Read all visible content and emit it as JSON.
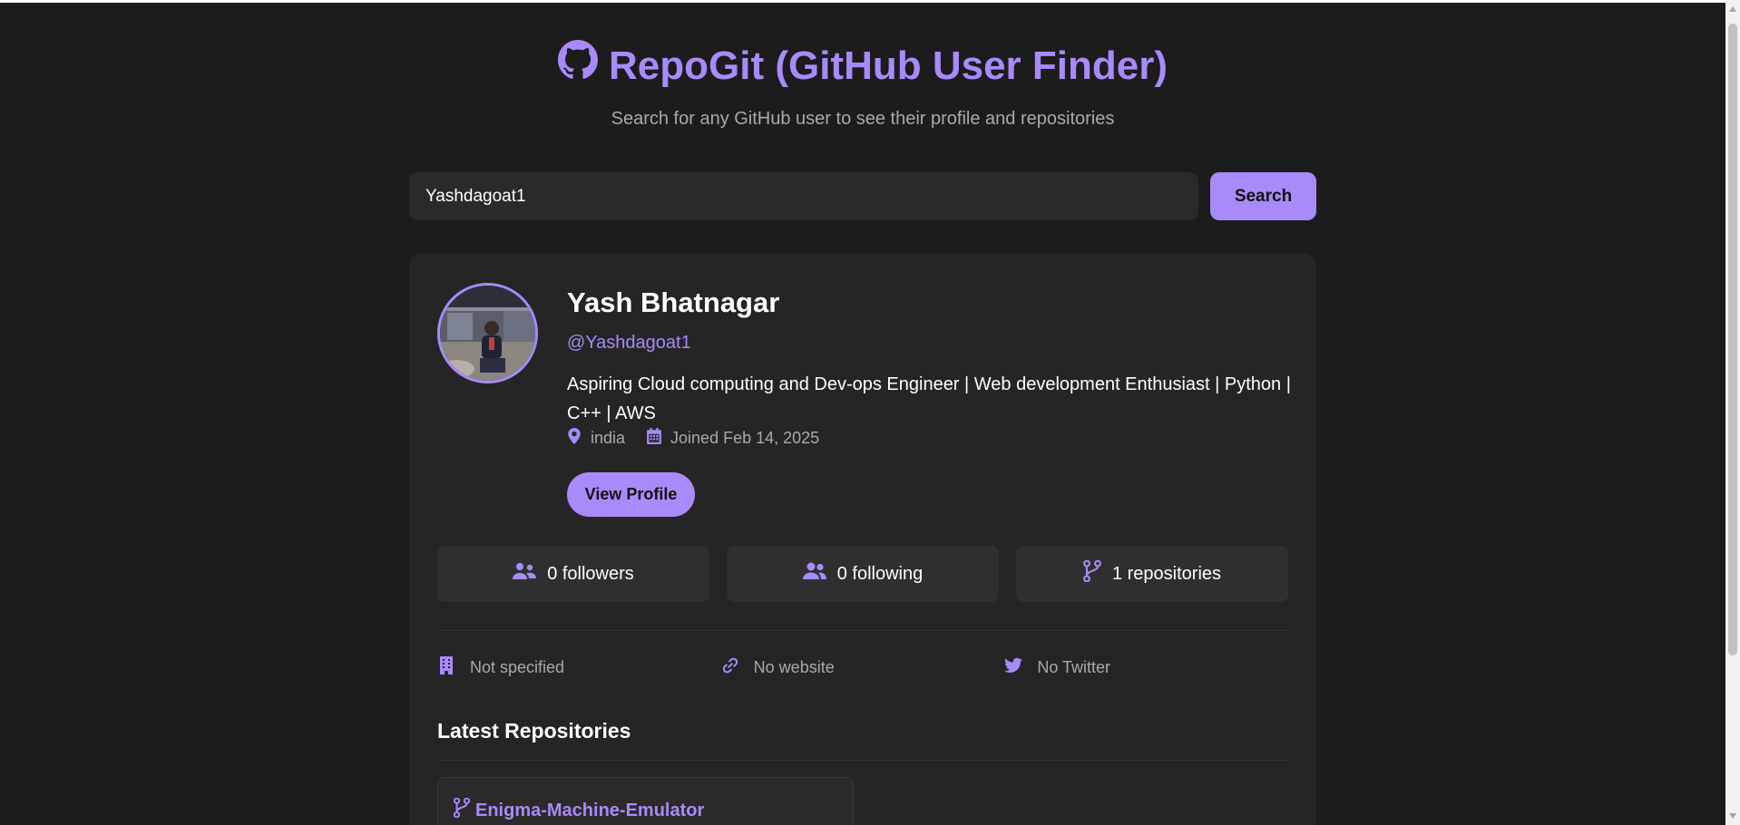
{
  "header": {
    "title": "RepoGit (GitHub User Finder)",
    "subtitle": "Search for any GitHub user to see their profile and repositories"
  },
  "search": {
    "value": "Yashdagoat1",
    "button_label": "Search"
  },
  "profile": {
    "name": "Yash Bhatnagar",
    "username": "@Yashdagoat1",
    "bio": "Aspiring Cloud computing and Dev-ops Engineer | Web development Enthusiast | Python | C++ | AWS",
    "location": "india",
    "joined": "Joined Feb 14, 2025",
    "view_button": "View Profile"
  },
  "stats": {
    "followers": "0 followers",
    "following": "0 following",
    "repositories": "1 repositories"
  },
  "links": {
    "company": "Not specified",
    "website": "No website",
    "twitter": "No Twitter"
  },
  "repos": {
    "section_title": "Latest Repositories",
    "items": [
      {
        "name": "Enigma-Machine-Emulator"
      }
    ]
  },
  "colors": {
    "accent": "#a78bfa",
    "background": "#1c1c1c",
    "card": "#252525"
  }
}
